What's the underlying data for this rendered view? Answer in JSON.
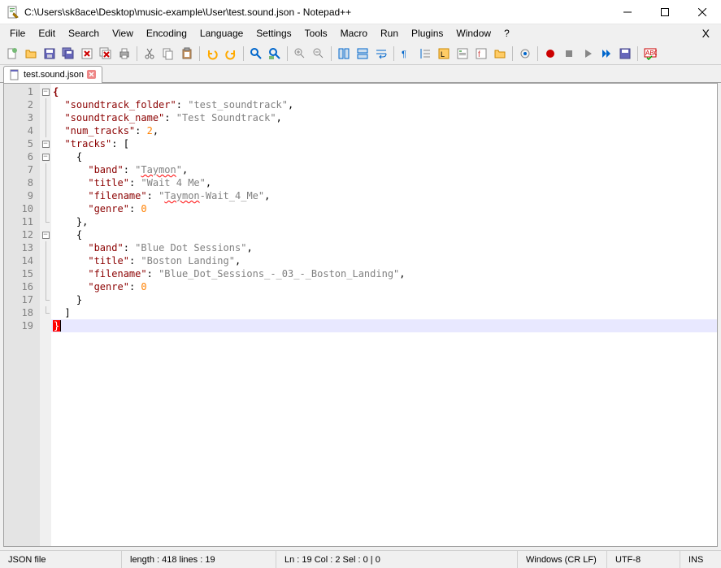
{
  "title": "C:\\Users\\sk8ace\\Desktop\\music-example\\User\\test.sound.json - Notepad++",
  "menu": [
    "File",
    "Edit",
    "Search",
    "View",
    "Encoding",
    "Language",
    "Settings",
    "Tools",
    "Macro",
    "Run",
    "Plugins",
    "Window",
    "?"
  ],
  "tab": {
    "label": "test.sound.json"
  },
  "code_lines": [
    [
      [
        "brace",
        "{"
      ]
    ],
    [
      [
        "pad",
        "  "
      ],
      [
        "key",
        "\"soundtrack_folder\""
      ],
      [
        "punct",
        ": "
      ],
      [
        "str",
        "\"test_soundtrack\""
      ],
      [
        "punct",
        ","
      ]
    ],
    [
      [
        "pad",
        "  "
      ],
      [
        "key",
        "\"soundtrack_name\""
      ],
      [
        "punct",
        ": "
      ],
      [
        "str",
        "\"Test Soundtrack\""
      ],
      [
        "punct",
        ","
      ]
    ],
    [
      [
        "pad",
        "  "
      ],
      [
        "key",
        "\"num_tracks\""
      ],
      [
        "punct",
        ": "
      ],
      [
        "num",
        "2"
      ],
      [
        "punct",
        ","
      ]
    ],
    [
      [
        "pad",
        "  "
      ],
      [
        "key",
        "\"tracks\""
      ],
      [
        "punct",
        ": ["
      ]
    ],
    [
      [
        "pad",
        "    "
      ],
      [
        "brace2",
        "{"
      ]
    ],
    [
      [
        "pad",
        "      "
      ],
      [
        "key",
        "\"band\""
      ],
      [
        "punct",
        ": "
      ],
      [
        "str",
        "\""
      ],
      [
        "wavy",
        "Taymon"
      ],
      [
        "str",
        "\""
      ],
      [
        "punct",
        ","
      ]
    ],
    [
      [
        "pad",
        "      "
      ],
      [
        "key",
        "\"title\""
      ],
      [
        "punct",
        ": "
      ],
      [
        "str",
        "\"Wait 4 Me\""
      ],
      [
        "punct",
        ","
      ]
    ],
    [
      [
        "pad",
        "      "
      ],
      [
        "key",
        "\"filename\""
      ],
      [
        "punct",
        ": "
      ],
      [
        "str",
        "\""
      ],
      [
        "wavy",
        "Taymon"
      ],
      [
        "str",
        "-Wait_4_Me\""
      ],
      [
        "punct",
        ","
      ]
    ],
    [
      [
        "pad",
        "      "
      ],
      [
        "key",
        "\"genre\""
      ],
      [
        "punct",
        ": "
      ],
      [
        "num",
        "0"
      ]
    ],
    [
      [
        "pad",
        "    "
      ],
      [
        "brace2",
        "}"
      ],
      [
        "punct",
        ","
      ]
    ],
    [
      [
        "pad",
        "    "
      ],
      [
        "brace2",
        "{"
      ]
    ],
    [
      [
        "pad",
        "      "
      ],
      [
        "key",
        "\"band\""
      ],
      [
        "punct",
        ": "
      ],
      [
        "str",
        "\"Blue Dot Sessions\""
      ],
      [
        "punct",
        ","
      ]
    ],
    [
      [
        "pad",
        "      "
      ],
      [
        "key",
        "\"title\""
      ],
      [
        "punct",
        ": "
      ],
      [
        "str",
        "\"Boston Landing\""
      ],
      [
        "punct",
        ","
      ]
    ],
    [
      [
        "pad",
        "      "
      ],
      [
        "key",
        "\"filename\""
      ],
      [
        "punct",
        ": "
      ],
      [
        "str",
        "\"Blue_Dot_Sessions_-_03_-_Boston_Landing\""
      ],
      [
        "punct",
        ","
      ]
    ],
    [
      [
        "pad",
        "      "
      ],
      [
        "key",
        "\"genre\""
      ],
      [
        "punct",
        ": "
      ],
      [
        "num",
        "0"
      ]
    ],
    [
      [
        "pad",
        "    "
      ],
      [
        "brace2",
        "}"
      ]
    ],
    [
      [
        "pad",
        "  "
      ],
      [
        "punct",
        "]"
      ]
    ],
    [
      [
        "redbrace",
        "}"
      ]
    ]
  ],
  "fold": [
    "box",
    "line",
    "line",
    "line",
    "box",
    "box",
    "line",
    "line",
    "line",
    "line",
    "end",
    "box",
    "line",
    "line",
    "line",
    "line",
    "end",
    "end",
    ""
  ],
  "status": {
    "type": "JSON file",
    "length": "length : 418    lines : 19",
    "pos": "Ln : 19    Col : 2    Sel : 0 | 0",
    "eol": "Windows (CR LF)",
    "enc": "UTF-8",
    "ins": "INS"
  },
  "line_count": 19,
  "highlight_line": 19
}
